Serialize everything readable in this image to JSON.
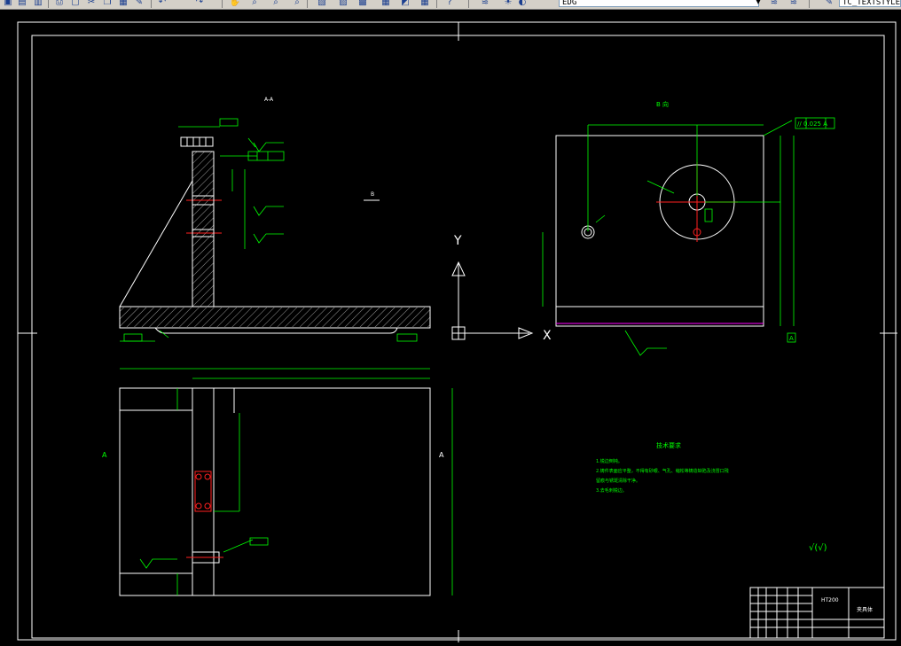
{
  "toolbar": {
    "layer_combo": "EDG",
    "style_combo": "TC_TEXTSTYLE",
    "icons": [
      "new-icon",
      "open-icon",
      "save-icon",
      "print-icon",
      "preview-icon",
      "cut-icon",
      "copy-icon",
      "paste-icon",
      "match-icon",
      "undo-icon",
      "redo-icon",
      "pan-icon",
      "zoom-realtime-icon",
      "zoom-window-icon",
      "zoom-previous-icon",
      "properties-icon",
      "design-center-icon",
      "tool-palette-icon",
      "sheet-set-icon",
      "markup-icon",
      "calculator-icon",
      "help-icon",
      "layer-manager-icon",
      "layer-state-icon",
      "layer-previous-icon"
    ]
  },
  "drawing": {
    "section_label": "A-A",
    "view_b_label": "B 向",
    "marker_b": "B",
    "ucs_y": "Y",
    "ucs_x": "X",
    "tech_title": "技术要求",
    "tech_lines": [
      "1.锐边倒钝。",
      "2.铸件表面应平整，不得有砂眼、气孔、缩松等铸造缺陷及浇冒口残",
      "留痕与锈斑清除干净。",
      "3.去毛刺锐边。"
    ],
    "roughness_note": "√(√)",
    "parallel_tol": "// 0.025 A",
    "perp_tol": "⊥ 0.025 A",
    "datum_a": "A",
    "title_block": {
      "material": "HT200",
      "part_name": "夹具体"
    },
    "left_mark": "A",
    "right_mark": "A"
  }
}
